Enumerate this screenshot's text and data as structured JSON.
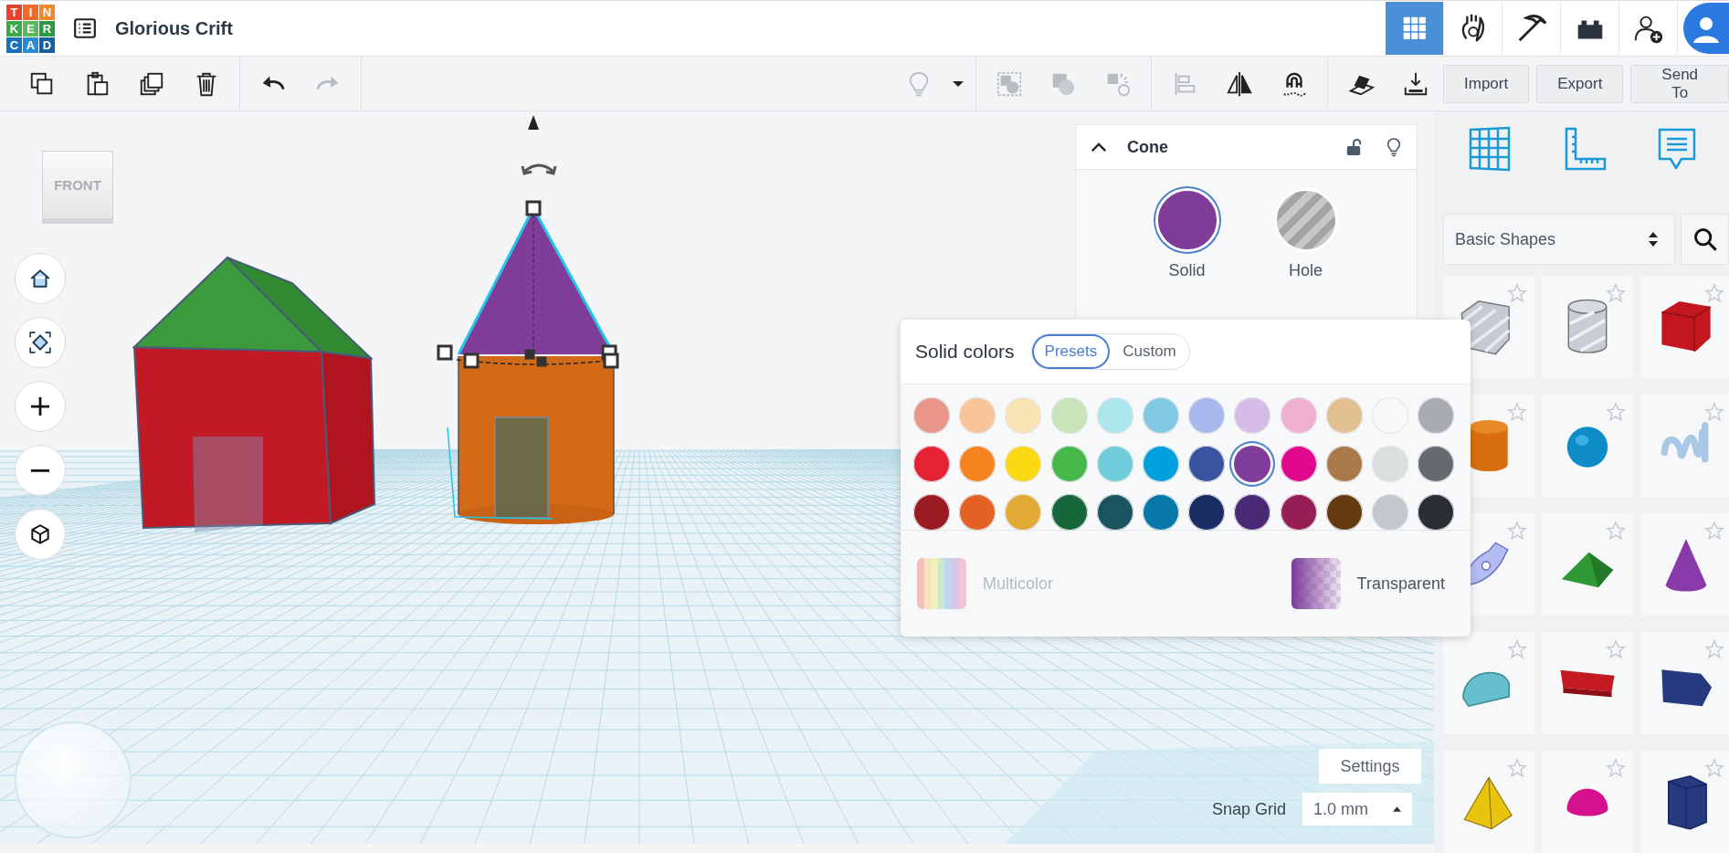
{
  "app": {
    "logo_letters": [
      "T",
      "I",
      "N",
      "K",
      "E",
      "R",
      "C",
      "A",
      "D"
    ],
    "title": "Glorious Crift"
  },
  "view_modes": [
    {
      "selected": true
    },
    {
      "selected": false
    },
    {
      "selected": false
    },
    {
      "selected": false
    },
    {
      "selected": false
    }
  ],
  "toolbar": {
    "tools": [
      {
        "disabled": false
      },
      {
        "disabled": false
      },
      {
        "disabled": false
      },
      {
        "disabled": false
      },
      {
        "disabled": false
      },
      {
        "disabled": true
      },
      {
        "disabled": true
      },
      {
        "disabled": false
      },
      {
        "disabled": true
      },
      {
        "disabled": true
      },
      {
        "disabled": true
      },
      {
        "disabled": true
      },
      {
        "disabled": false
      },
      {
        "disabled": false
      },
      {
        "disabled": false
      },
      {
        "disabled": false
      }
    ],
    "buttons": [
      "Import",
      "Export",
      "Send To"
    ]
  },
  "view_cube": {
    "label": "FRONT"
  },
  "inspector": {
    "title": "Cone",
    "locked": false,
    "types": [
      {
        "label": "Solid",
        "selected": true
      },
      {
        "label": "Hole",
        "selected": false
      }
    ]
  },
  "color_picker": {
    "title": "Solid colors",
    "tabs": [
      {
        "label": "Presets",
        "selected": true
      },
      {
        "label": "Custom",
        "selected": false
      }
    ],
    "swatches": [
      {
        "color": "#e8968a",
        "selected": false
      },
      {
        "color": "#f8c498",
        "selected": false
      },
      {
        "color": "#f8e3b4",
        "selected": false
      },
      {
        "color": "#c8e4b8",
        "selected": false
      },
      {
        "color": "#aee6ee",
        "selected": false
      },
      {
        "color": "#80c8e4",
        "selected": false
      },
      {
        "color": "#a8b8ec",
        "selected": false
      },
      {
        "color": "#d4bce6",
        "selected": false
      },
      {
        "color": "#f0b0d2",
        "selected": false
      },
      {
        "color": "#e2c092",
        "selected": false
      },
      {
        "color": "#f8f8f8",
        "selected": false
      },
      {
        "color": "#a8acb0",
        "selected": false
      },
      {
        "color": "#e52232",
        "selected": false
      },
      {
        "color": "#f58420",
        "selected": false
      },
      {
        "color": "#fcd915",
        "selected": false
      },
      {
        "color": "#46b84a",
        "selected": false
      },
      {
        "color": "#70ccd8",
        "selected": false
      },
      {
        "color": "#00a0dc",
        "selected": false
      },
      {
        "color": "#3a54a0",
        "selected": false
      },
      {
        "color": "#7f3c98",
        "selected": true
      },
      {
        "color": "#e0078c",
        "selected": false
      },
      {
        "color": "#a87a4a",
        "selected": false
      },
      {
        "color": "#dcdfe0",
        "selected": false
      },
      {
        "color": "#646a6e",
        "selected": false
      },
      {
        "color": "#9a1c22",
        "selected": false
      },
      {
        "color": "#e46024",
        "selected": false
      },
      {
        "color": "#e2aa34",
        "selected": false
      },
      {
        "color": "#16683a",
        "selected": false
      },
      {
        "color": "#1a5460",
        "selected": false
      },
      {
        "color": "#0878a8",
        "selected": false
      },
      {
        "color": "#1a2c64",
        "selected": false
      },
      {
        "color": "#4a2a74",
        "selected": false
      },
      {
        "color": "#961e54",
        "selected": false
      },
      {
        "color": "#643a10",
        "selected": false
      },
      {
        "color": "#c4c8cc",
        "selected": false
      },
      {
        "color": "#2a2e32",
        "selected": false
      }
    ],
    "options": [
      {
        "label": "Multicolor",
        "disabled": true
      },
      {
        "label": "Transparent",
        "disabled": false
      }
    ]
  },
  "sidebar": {
    "category": "Basic Shapes",
    "shapes": [
      {
        "starred": false
      },
      {
        "starred": false
      },
      {
        "starred": false
      },
      {
        "starred": false
      },
      {
        "starred": false
      },
      {
        "starred": false
      },
      {
        "starred": false
      },
      {
        "starred": false
      },
      {
        "starred": false
      },
      {
        "starred": false
      },
      {
        "starred": false
      },
      {
        "starred": false
      },
      {
        "starred": false
      },
      {
        "starred": false
      },
      {
        "starred": false
      }
    ]
  },
  "grid_settings": {
    "button": "Settings",
    "snap_label": "Snap Grid",
    "snap_value": "1.0 mm"
  }
}
